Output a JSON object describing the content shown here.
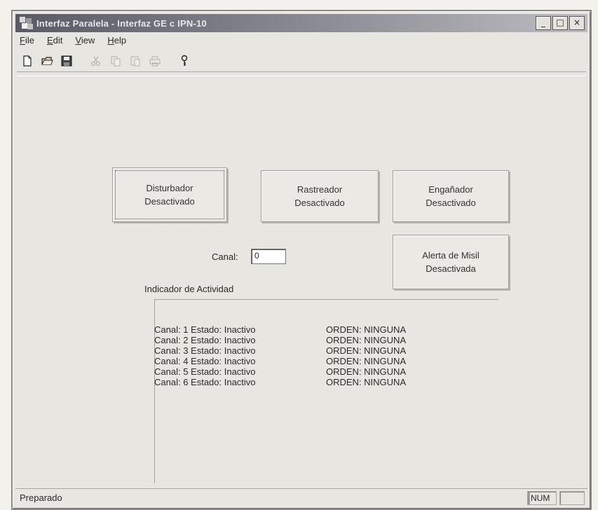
{
  "window": {
    "title": "Interfaz Paralela - Interfaz GE c IPN-10"
  },
  "controls": {
    "minimize": "_",
    "maximize": "□",
    "close": "×"
  },
  "menu": [
    "File",
    "Edit",
    "View",
    "Help"
  ],
  "toolbar": [
    "new-icon",
    "open-icon",
    "save-icon",
    "cut-icon",
    "copy-icon",
    "paste-icon",
    "print-icon",
    "help-icon"
  ],
  "buttons": {
    "disturbador": {
      "line1": "Disturbador",
      "line2": "Desactivado"
    },
    "rastreador": {
      "line1": "Rastreador",
      "line2": "Desactivado"
    },
    "enganador": {
      "line1": "Engañador",
      "line2": "Desactivado"
    },
    "alerta": {
      "line1": "Alerta de Misil",
      "line2": "Desactivada"
    }
  },
  "canal": {
    "label": "Canal:",
    "value": "0"
  },
  "actividad": {
    "title": "Indicador de Actividad",
    "rows": [
      {
        "estado": "Canal:  1 Estado: Inactivo",
        "orden": "ORDEN: NINGUNA"
      },
      {
        "estado": "Canal:  2 Estado: Inactivo",
        "orden": "ORDEN: NINGUNA"
      },
      {
        "estado": "Canal:  3 Estado: Inactivo",
        "orden": "ORDEN: NINGUNA"
      },
      {
        "estado": "Canal:  4 Estado: Inactivo",
        "orden": "ORDEN: NINGUNA"
      },
      {
        "estado": "Canal:  5 Estado: Inactivo",
        "orden": "ORDEN: NINGUNA"
      },
      {
        "estado": "Canal:  6 Estado: Inactivo",
        "orden": "ORDEN: NINGUNA"
      }
    ]
  },
  "statusbar": {
    "text": "Preparado",
    "num": "NUM"
  }
}
